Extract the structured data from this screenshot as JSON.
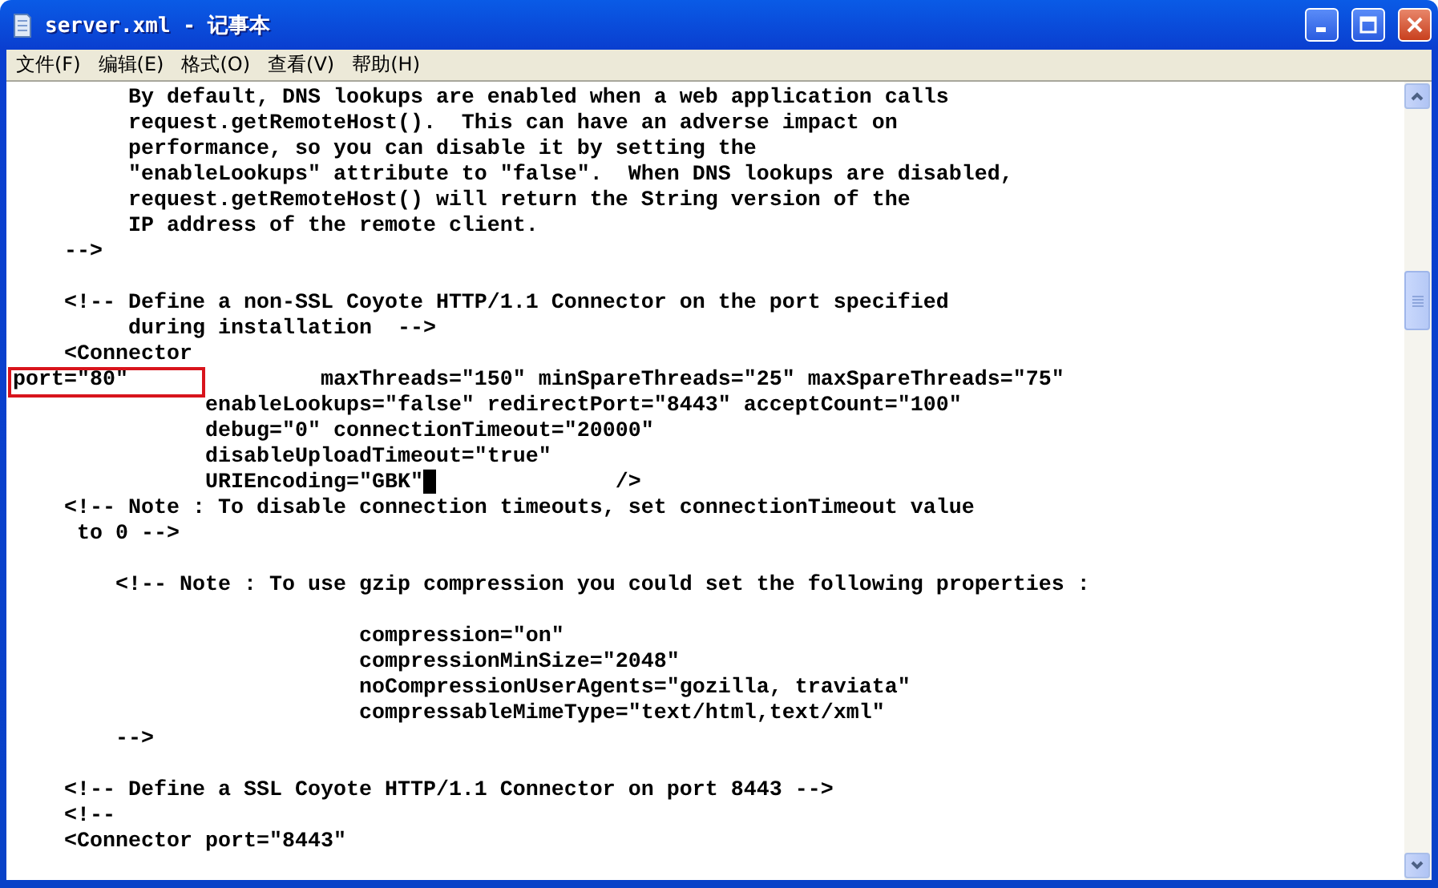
{
  "window": {
    "title": "server.xml - 记事本"
  },
  "menu": [
    {
      "label": "文件(F)"
    },
    {
      "label": "编辑(E)"
    },
    {
      "label": "格式(O)"
    },
    {
      "label": "查看(V)"
    },
    {
      "label": "帮助(H)"
    }
  ],
  "lines": [
    {
      "kind": "code",
      "text": "         By default, DNS lookups are enabled when a web application calls"
    },
    {
      "kind": "code",
      "text": "         request.getRemoteHost().  This can have an adverse impact on"
    },
    {
      "kind": "code",
      "text": "         performance, so you can disable it by setting the"
    },
    {
      "kind": "code",
      "text": "         \"enableLookups\" attribute to \"false\".  When DNS lookups are disabled,"
    },
    {
      "kind": "code",
      "text": "         request.getRemoteHost() will return the String version of the"
    },
    {
      "kind": "code",
      "text": "         IP address of the remote client."
    },
    {
      "kind": "code",
      "text": "    -->"
    },
    {
      "kind": "blank"
    },
    {
      "kind": "code",
      "text": "    <!-- Define a non-SSL Coyote HTTP/1.1 Connector on the port specified"
    },
    {
      "kind": "code",
      "text": "         during installation  -->"
    },
    {
      "kind": "code",
      "text": "    <Connector"
    },
    {
      "kind": "code",
      "text": "port=\"80\"               maxThreads=\"150\" minSpareThreads=\"25\" maxSpareThreads=\"75\"",
      "highlighted": true
    },
    {
      "kind": "code",
      "text": "               enableLookups=\"false\" redirectPort=\"8443\" acceptCount=\"100\""
    },
    {
      "kind": "code",
      "text": "               debug=\"0\" connectionTimeout=\"20000\""
    },
    {
      "kind": "code",
      "text": "               disableUploadTimeout=\"true\""
    },
    {
      "kind": "code",
      "text": "               URIEncoding=\"GBK\"█              />"
    },
    {
      "kind": "code",
      "text": "    <!-- Note : To disable connection timeouts, set connectionTimeout value"
    },
    {
      "kind": "code",
      "text": "     to 0 -->"
    },
    {
      "kind": "blank"
    },
    {
      "kind": "code",
      "text": "        <!-- Note : To use gzip compression you could set the following properties :"
    },
    {
      "kind": "blank"
    },
    {
      "kind": "code",
      "text": "                           compression=\"on\""
    },
    {
      "kind": "code",
      "text": "                           compressionMinSize=\"2048\""
    },
    {
      "kind": "code",
      "text": "                           noCompressionUserAgents=\"gozilla, traviata\""
    },
    {
      "kind": "code",
      "text": "                           compressableMimeType=\"text/html,text/xml\""
    },
    {
      "kind": "code",
      "text": "        -->"
    },
    {
      "kind": "blank"
    },
    {
      "kind": "code",
      "text": "    <!-- Define a SSL Coyote HTTP/1.1 Connector on port 8443 -->"
    },
    {
      "kind": "code",
      "text": "    <!--"
    },
    {
      "kind": "code",
      "text": "    <Connector port=\"8443\""
    }
  ]
}
